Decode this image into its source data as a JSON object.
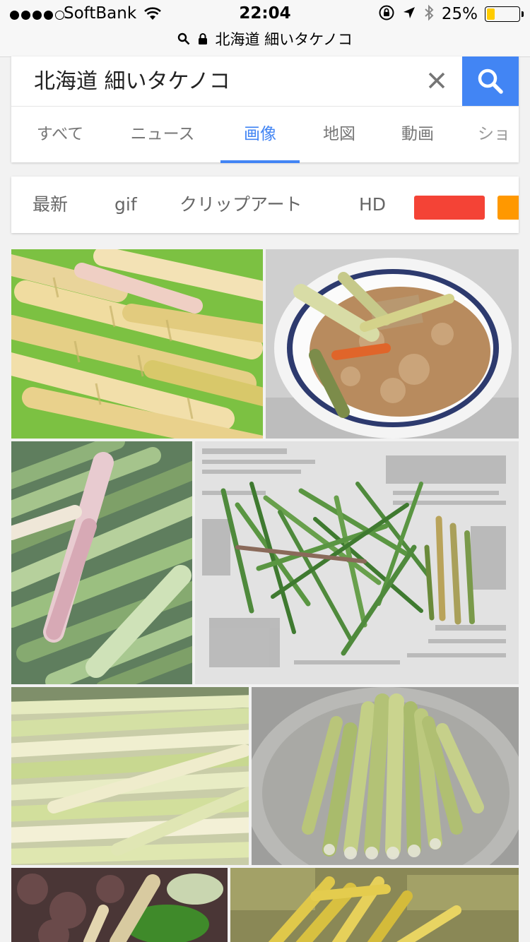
{
  "status": {
    "carrier": "SoftBank",
    "time": "22:04",
    "battery_percent": "25%",
    "battery_level": 0.25,
    "url": "北海道  細いタケノコ"
  },
  "search": {
    "query": "北海道  細いタケノコ"
  },
  "tabs": [
    {
      "label": "すべて"
    },
    {
      "label": "ニュース"
    },
    {
      "label": "画像"
    },
    {
      "label": "地図"
    },
    {
      "label": "動画"
    },
    {
      "label": "ショ"
    }
  ],
  "filters": {
    "chips": [
      "最新",
      "gif",
      "クリップアート",
      "HD"
    ],
    "color_swatches": [
      "#f44336",
      "#ff9800"
    ]
  },
  "colors": {
    "accent": "#4285f4"
  },
  "results": [
    {
      "subject": "bamboo-shoots-yellow",
      "icon": "photo"
    },
    {
      "subject": "takikomi-rice-bowl",
      "icon": "photo"
    },
    {
      "subject": "green-bamboo-shoots",
      "icon": "photo"
    },
    {
      "subject": "shoots-on-newspaper",
      "icon": "photo"
    },
    {
      "subject": "peeled-shoots-pile",
      "icon": "photo"
    },
    {
      "subject": "shoots-in-glass-bowl",
      "icon": "photo"
    },
    {
      "subject": "shoots-with-vegetables",
      "icon": "photo"
    },
    {
      "subject": "shoots-on-leaves",
      "icon": "photo"
    }
  ]
}
